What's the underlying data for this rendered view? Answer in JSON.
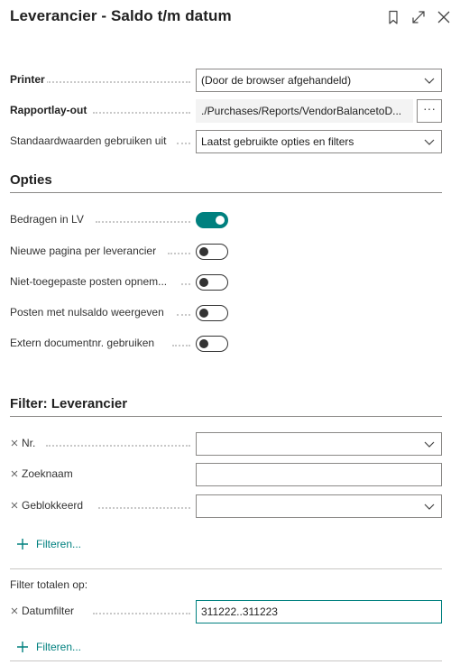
{
  "header": {
    "title": "Leverancier - Saldo t/m datum",
    "icons": [
      "bookmark-icon",
      "expand-icon",
      "close-icon"
    ]
  },
  "settings": {
    "printer_label": "Printer",
    "printer_value": "(Door de browser afgehandeld)",
    "layout_label": "Rapportlay-out",
    "layout_value": "./Purchases/Reports/VendorBalancetoD...",
    "layout_button": "···",
    "defaults_label": "Standaardwaarden gebruiken uit",
    "defaults_value": "Laatst gebruikte opties en filters"
  },
  "options": {
    "title": "Opties",
    "items": [
      {
        "label": "Bedragen in LV",
        "on": true
      },
      {
        "label": "Nieuwe pagina per leverancier",
        "on": false
      },
      {
        "label": "Niet-toegepaste posten opnem...",
        "on": false
      },
      {
        "label": "Posten met nulsaldo weergeven",
        "on": false
      },
      {
        "label": "Extern documentnr. gebruiken",
        "on": false
      }
    ]
  },
  "vendor_filter": {
    "title": "Filter: Leverancier",
    "fields": [
      {
        "label": "Nr.",
        "value": "",
        "type": "dropdown"
      },
      {
        "label": "Zoeknaam",
        "value": "",
        "type": "text"
      },
      {
        "label": "Geblokkeerd",
        "value": "",
        "type": "dropdown"
      }
    ],
    "add_filter": "Filteren..."
  },
  "totals_filter": {
    "title": "Filter totalen op:",
    "date_label": "Datumfilter",
    "date_value": "311222..311223",
    "add_filter": "Filteren..."
  },
  "colors": {
    "accent": "#00807f",
    "border": "#8a8886"
  }
}
